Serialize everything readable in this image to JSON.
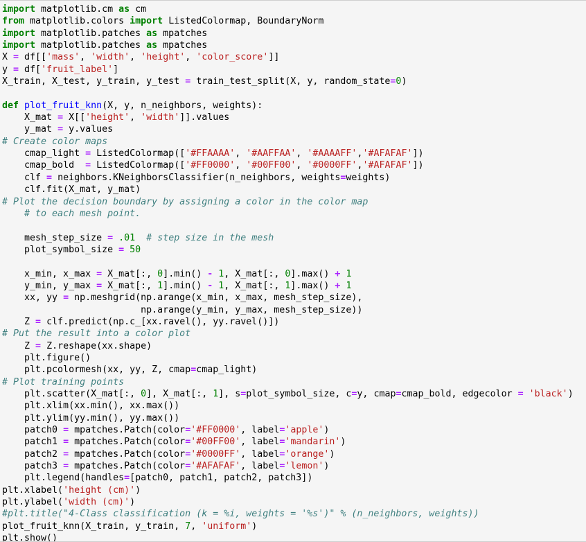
{
  "cell": {
    "type": "code-cell",
    "language": "python",
    "background_color": "#f5f5f5",
    "border_color": "#cfcfcf",
    "theme": {
      "keyword_color": "#008000",
      "function_color": "#0000FF",
      "string_color": "#BA2121",
      "number_color": "#008000",
      "operator_color": "#AA22FF",
      "comment_color": "#408080",
      "text_color": "#000000"
    }
  },
  "lines": [
    {
      "i": 1,
      "tokens": [
        {
          "t": "k",
          "v": "import"
        },
        {
          "t": "p",
          "v": " matplotlib.cm "
        },
        {
          "t": "k",
          "v": "as"
        },
        {
          "t": "p",
          "v": " cm"
        }
      ]
    },
    {
      "i": 2,
      "tokens": [
        {
          "t": "k",
          "v": "from"
        },
        {
          "t": "p",
          "v": " matplotlib.colors "
        },
        {
          "t": "k",
          "v": "import"
        },
        {
          "t": "p",
          "v": " ListedColormap, BoundaryNorm"
        }
      ]
    },
    {
      "i": 3,
      "tokens": [
        {
          "t": "k",
          "v": "import"
        },
        {
          "t": "p",
          "v": " matplotlib.patches "
        },
        {
          "t": "k",
          "v": "as"
        },
        {
          "t": "p",
          "v": " mpatches"
        }
      ]
    },
    {
      "i": 4,
      "tokens": [
        {
          "t": "k",
          "v": "import"
        },
        {
          "t": "p",
          "v": " matplotlib.patches "
        },
        {
          "t": "k",
          "v": "as"
        },
        {
          "t": "p",
          "v": " mpatches"
        }
      ]
    },
    {
      "i": 5,
      "tokens": [
        {
          "t": "p",
          "v": "X "
        },
        {
          "t": "o",
          "v": "="
        },
        {
          "t": "p",
          "v": " df[["
        },
        {
          "t": "s",
          "v": "'mass'"
        },
        {
          "t": "p",
          "v": ", "
        },
        {
          "t": "s",
          "v": "'width'"
        },
        {
          "t": "p",
          "v": ", "
        },
        {
          "t": "s",
          "v": "'height'"
        },
        {
          "t": "p",
          "v": ", "
        },
        {
          "t": "s",
          "v": "'color_score'"
        },
        {
          "t": "p",
          "v": "]]"
        }
      ]
    },
    {
      "i": 6,
      "tokens": [
        {
          "t": "p",
          "v": "y "
        },
        {
          "t": "o",
          "v": "="
        },
        {
          "t": "p",
          "v": " df["
        },
        {
          "t": "s",
          "v": "'fruit_label'"
        },
        {
          "t": "p",
          "v": "]"
        }
      ]
    },
    {
      "i": 7,
      "tokens": [
        {
          "t": "p",
          "v": "X_train, X_test, y_train, y_test "
        },
        {
          "t": "o",
          "v": "="
        },
        {
          "t": "p",
          "v": " train_test_split(X, y, random_state"
        },
        {
          "t": "o",
          "v": "="
        },
        {
          "t": "n",
          "v": "0"
        },
        {
          "t": "p",
          "v": ")"
        }
      ]
    },
    {
      "i": 8,
      "tokens": []
    },
    {
      "i": 9,
      "tokens": [
        {
          "t": "k",
          "v": "def"
        },
        {
          "t": "p",
          "v": " "
        },
        {
          "t": "fn",
          "v": "plot_fruit_knn"
        },
        {
          "t": "p",
          "v": "(X, y, n_neighbors, weights):"
        }
      ]
    },
    {
      "i": 10,
      "tokens": [
        {
          "t": "p",
          "v": "    X_mat "
        },
        {
          "t": "o",
          "v": "="
        },
        {
          "t": "p",
          "v": " X[["
        },
        {
          "t": "s",
          "v": "'height'"
        },
        {
          "t": "p",
          "v": ", "
        },
        {
          "t": "s",
          "v": "'width'"
        },
        {
          "t": "p",
          "v": "]].values"
        }
      ]
    },
    {
      "i": 11,
      "tokens": [
        {
          "t": "p",
          "v": "    y_mat "
        },
        {
          "t": "o",
          "v": "="
        },
        {
          "t": "p",
          "v": " y.values"
        }
      ]
    },
    {
      "i": 12,
      "tokens": [
        {
          "t": "c",
          "v": "# Create color maps"
        }
      ]
    },
    {
      "i": 13,
      "tokens": [
        {
          "t": "p",
          "v": "    cmap_light "
        },
        {
          "t": "o",
          "v": "="
        },
        {
          "t": "p",
          "v": " ListedColormap(["
        },
        {
          "t": "s",
          "v": "'#FFAAAA'"
        },
        {
          "t": "p",
          "v": ", "
        },
        {
          "t": "s",
          "v": "'#AAFFAA'"
        },
        {
          "t": "p",
          "v": ", "
        },
        {
          "t": "s",
          "v": "'#AAAAFF'"
        },
        {
          "t": "p",
          "v": ","
        },
        {
          "t": "s",
          "v": "'#AFAFAF'"
        },
        {
          "t": "p",
          "v": "])"
        }
      ]
    },
    {
      "i": 14,
      "tokens": [
        {
          "t": "p",
          "v": "    cmap_bold  "
        },
        {
          "t": "o",
          "v": "="
        },
        {
          "t": "p",
          "v": " ListedColormap(["
        },
        {
          "t": "s",
          "v": "'#FF0000'"
        },
        {
          "t": "p",
          "v": ", "
        },
        {
          "t": "s",
          "v": "'#00FF00'"
        },
        {
          "t": "p",
          "v": ", "
        },
        {
          "t": "s",
          "v": "'#0000FF'"
        },
        {
          "t": "p",
          "v": ","
        },
        {
          "t": "s",
          "v": "'#AFAFAF'"
        },
        {
          "t": "p",
          "v": "])"
        }
      ]
    },
    {
      "i": 15,
      "tokens": [
        {
          "t": "p",
          "v": "    clf "
        },
        {
          "t": "o",
          "v": "="
        },
        {
          "t": "p",
          "v": " neighbors.KNeighborsClassifier(n_neighbors, weights"
        },
        {
          "t": "o",
          "v": "="
        },
        {
          "t": "p",
          "v": "weights)"
        }
      ]
    },
    {
      "i": 16,
      "tokens": [
        {
          "t": "p",
          "v": "    clf.fit(X_mat, y_mat)"
        }
      ]
    },
    {
      "i": 17,
      "tokens": [
        {
          "t": "c",
          "v": "# Plot the decision boundary by assigning a color in the color map"
        }
      ]
    },
    {
      "i": 18,
      "tokens": [
        {
          "t": "c",
          "v": "    # to each mesh point."
        }
      ]
    },
    {
      "i": 19,
      "tokens": []
    },
    {
      "i": 20,
      "tokens": [
        {
          "t": "p",
          "v": "    mesh_step_size "
        },
        {
          "t": "o",
          "v": "="
        },
        {
          "t": "p",
          "v": " "
        },
        {
          "t": "n",
          "v": ".01"
        },
        {
          "t": "p",
          "v": "  "
        },
        {
          "t": "c",
          "v": "# step size in the mesh"
        }
      ]
    },
    {
      "i": 21,
      "tokens": [
        {
          "t": "p",
          "v": "    plot_symbol_size "
        },
        {
          "t": "o",
          "v": "="
        },
        {
          "t": "p",
          "v": " "
        },
        {
          "t": "n",
          "v": "50"
        }
      ]
    },
    {
      "i": 22,
      "tokens": []
    },
    {
      "i": 23,
      "tokens": [
        {
          "t": "p",
          "v": "    x_min, x_max "
        },
        {
          "t": "o",
          "v": "="
        },
        {
          "t": "p",
          "v": " X_mat[:, "
        },
        {
          "t": "n",
          "v": "0"
        },
        {
          "t": "p",
          "v": "].min() "
        },
        {
          "t": "o",
          "v": "-"
        },
        {
          "t": "p",
          "v": " "
        },
        {
          "t": "n",
          "v": "1"
        },
        {
          "t": "p",
          "v": ", X_mat[:, "
        },
        {
          "t": "n",
          "v": "0"
        },
        {
          "t": "p",
          "v": "].max() "
        },
        {
          "t": "o",
          "v": "+"
        },
        {
          "t": "p",
          "v": " "
        },
        {
          "t": "n",
          "v": "1"
        }
      ]
    },
    {
      "i": 24,
      "tokens": [
        {
          "t": "p",
          "v": "    y_min, y_max "
        },
        {
          "t": "o",
          "v": "="
        },
        {
          "t": "p",
          "v": " X_mat[:, "
        },
        {
          "t": "n",
          "v": "1"
        },
        {
          "t": "p",
          "v": "].min() "
        },
        {
          "t": "o",
          "v": "-"
        },
        {
          "t": "p",
          "v": " "
        },
        {
          "t": "n",
          "v": "1"
        },
        {
          "t": "p",
          "v": ", X_mat[:, "
        },
        {
          "t": "n",
          "v": "1"
        },
        {
          "t": "p",
          "v": "].max() "
        },
        {
          "t": "o",
          "v": "+"
        },
        {
          "t": "p",
          "v": " "
        },
        {
          "t": "n",
          "v": "1"
        }
      ]
    },
    {
      "i": 25,
      "tokens": [
        {
          "t": "p",
          "v": "    xx, yy "
        },
        {
          "t": "o",
          "v": "="
        },
        {
          "t": "p",
          "v": " np.meshgrid(np.arange(x_min, x_max, mesh_step_size),"
        }
      ]
    },
    {
      "i": 26,
      "tokens": [
        {
          "t": "p",
          "v": "                         np.arange(y_min, y_max, mesh_step_size))"
        }
      ]
    },
    {
      "i": 27,
      "tokens": [
        {
          "t": "p",
          "v": "    Z "
        },
        {
          "t": "o",
          "v": "="
        },
        {
          "t": "p",
          "v": " clf.predict(np.c_[xx.ravel(), yy.ravel()])"
        }
      ]
    },
    {
      "i": 28,
      "tokens": [
        {
          "t": "c",
          "v": "# Put the result into a color plot"
        }
      ]
    },
    {
      "i": 29,
      "tokens": [
        {
          "t": "p",
          "v": "    Z "
        },
        {
          "t": "o",
          "v": "="
        },
        {
          "t": "p",
          "v": " Z.reshape(xx.shape)"
        }
      ]
    },
    {
      "i": 30,
      "tokens": [
        {
          "t": "p",
          "v": "    plt.figure()"
        }
      ]
    },
    {
      "i": 31,
      "tokens": [
        {
          "t": "p",
          "v": "    plt.pcolormesh(xx, yy, Z, cmap"
        },
        {
          "t": "o",
          "v": "="
        },
        {
          "t": "p",
          "v": "cmap_light)"
        }
      ]
    },
    {
      "i": 32,
      "tokens": [
        {
          "t": "c",
          "v": "# Plot training points"
        }
      ]
    },
    {
      "i": 33,
      "tokens": [
        {
          "t": "p",
          "v": "    plt.scatter(X_mat[:, "
        },
        {
          "t": "n",
          "v": "0"
        },
        {
          "t": "p",
          "v": "], X_mat[:, "
        },
        {
          "t": "n",
          "v": "1"
        },
        {
          "t": "p",
          "v": "], s"
        },
        {
          "t": "o",
          "v": "="
        },
        {
          "t": "p",
          "v": "plot_symbol_size, c"
        },
        {
          "t": "o",
          "v": "="
        },
        {
          "t": "p",
          "v": "y, cmap"
        },
        {
          "t": "o",
          "v": "="
        },
        {
          "t": "p",
          "v": "cmap_bold, edgecolor "
        },
        {
          "t": "o",
          "v": "="
        },
        {
          "t": "p",
          "v": " "
        },
        {
          "t": "s",
          "v": "'black'"
        },
        {
          "t": "p",
          "v": ")"
        }
      ]
    },
    {
      "i": 34,
      "tokens": [
        {
          "t": "p",
          "v": "    plt.xlim(xx.min(), xx.max())"
        }
      ]
    },
    {
      "i": 35,
      "tokens": [
        {
          "t": "p",
          "v": "    plt.ylim(yy.min(), yy.max())"
        }
      ]
    },
    {
      "i": 36,
      "tokens": [
        {
          "t": "p",
          "v": "    patch0 "
        },
        {
          "t": "o",
          "v": "="
        },
        {
          "t": "p",
          "v": " mpatches.Patch(color"
        },
        {
          "t": "o",
          "v": "="
        },
        {
          "t": "s",
          "v": "'#FF0000'"
        },
        {
          "t": "p",
          "v": ", label"
        },
        {
          "t": "o",
          "v": "="
        },
        {
          "t": "s",
          "v": "'apple'"
        },
        {
          "t": "p",
          "v": ")"
        }
      ]
    },
    {
      "i": 37,
      "tokens": [
        {
          "t": "p",
          "v": "    patch1 "
        },
        {
          "t": "o",
          "v": "="
        },
        {
          "t": "p",
          "v": " mpatches.Patch(color"
        },
        {
          "t": "o",
          "v": "="
        },
        {
          "t": "s",
          "v": "'#00FF00'"
        },
        {
          "t": "p",
          "v": ", label"
        },
        {
          "t": "o",
          "v": "="
        },
        {
          "t": "s",
          "v": "'mandarin'"
        },
        {
          "t": "p",
          "v": ")"
        }
      ]
    },
    {
      "i": 38,
      "tokens": [
        {
          "t": "p",
          "v": "    patch2 "
        },
        {
          "t": "o",
          "v": "="
        },
        {
          "t": "p",
          "v": " mpatches.Patch(color"
        },
        {
          "t": "o",
          "v": "="
        },
        {
          "t": "s",
          "v": "'#0000FF'"
        },
        {
          "t": "p",
          "v": ", label"
        },
        {
          "t": "o",
          "v": "="
        },
        {
          "t": "s",
          "v": "'orange'"
        },
        {
          "t": "p",
          "v": ")"
        }
      ]
    },
    {
      "i": 39,
      "tokens": [
        {
          "t": "p",
          "v": "    patch3 "
        },
        {
          "t": "o",
          "v": "="
        },
        {
          "t": "p",
          "v": " mpatches.Patch(color"
        },
        {
          "t": "o",
          "v": "="
        },
        {
          "t": "s",
          "v": "'#AFAFAF'"
        },
        {
          "t": "p",
          "v": ", label"
        },
        {
          "t": "o",
          "v": "="
        },
        {
          "t": "s",
          "v": "'lemon'"
        },
        {
          "t": "p",
          "v": ")"
        }
      ]
    },
    {
      "i": 40,
      "tokens": [
        {
          "t": "p",
          "v": "    plt.legend(handles"
        },
        {
          "t": "o",
          "v": "="
        },
        {
          "t": "p",
          "v": "[patch0, patch1, patch2, patch3])"
        }
      ]
    },
    {
      "i": 41,
      "tokens": [
        {
          "t": "p",
          "v": "plt.xlabel("
        },
        {
          "t": "s",
          "v": "'height (cm)'"
        },
        {
          "t": "p",
          "v": ")"
        }
      ]
    },
    {
      "i": 42,
      "tokens": [
        {
          "t": "p",
          "v": "plt.ylabel("
        },
        {
          "t": "s",
          "v": "'width (cm)'"
        },
        {
          "t": "p",
          "v": ")"
        }
      ]
    },
    {
      "i": 43,
      "tokens": [
        {
          "t": "c",
          "v": "#plt.title(\"4-Class classification (k = %i, weights = '%s')\" % (n_neighbors, weights))"
        }
      ]
    },
    {
      "i": 44,
      "tokens": [
        {
          "t": "p",
          "v": "plot_fruit_knn(X_train, y_train, "
        },
        {
          "t": "n",
          "v": "7"
        },
        {
          "t": "p",
          "v": ", "
        },
        {
          "t": "s",
          "v": "'uniform'"
        },
        {
          "t": "p",
          "v": ")"
        }
      ]
    },
    {
      "i": 45,
      "tokens": [
        {
          "t": "p",
          "v": "plt.show()"
        }
      ]
    }
  ]
}
